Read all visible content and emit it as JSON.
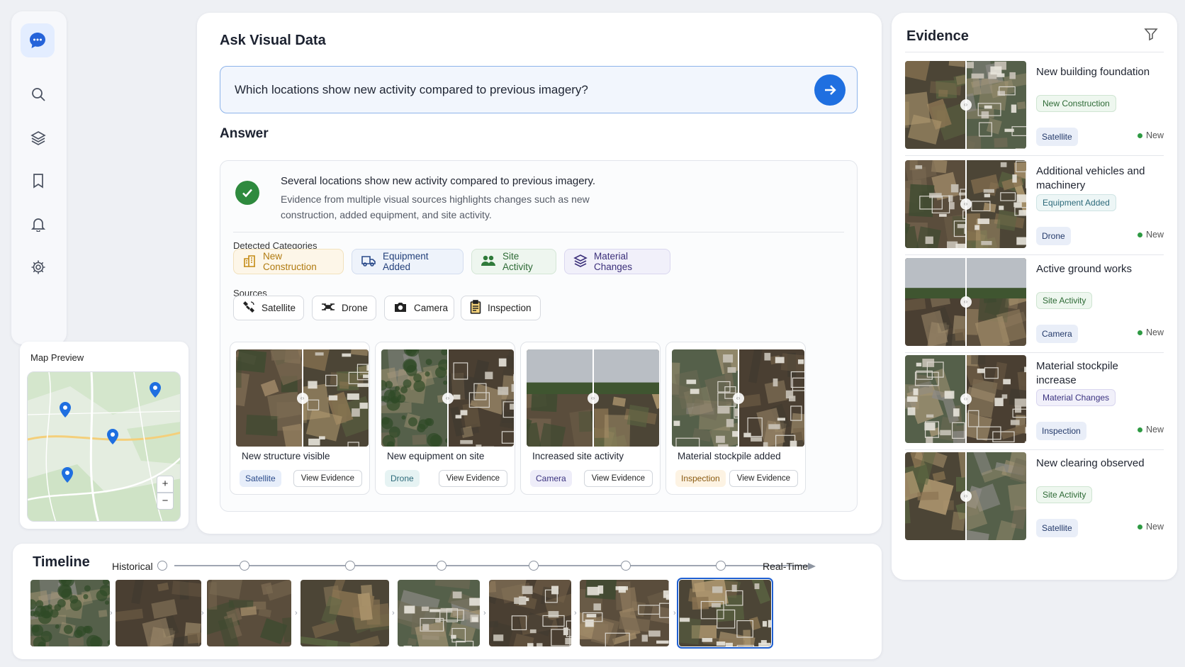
{
  "sidebar": {
    "items": [
      {
        "icon": "search-icon"
      },
      {
        "icon": "layers-icon"
      },
      {
        "icon": "bookmark-icon"
      },
      {
        "icon": "bell-icon"
      },
      {
        "icon": "gear-icon"
      }
    ]
  },
  "map": {
    "title": "Map Preview",
    "zoom_in": "+",
    "zoom_out": "−"
  },
  "ask": {
    "title": "Ask Visual Data",
    "query": "Which locations show new activity compared to previous imagery?"
  },
  "answer": {
    "title": "Answer",
    "summary": "Several locations show new activity compared to previous imagery.",
    "detail": "Evidence from multiple visual sources highlights changes such as new construction, added equipment, and site activity.",
    "categories_label": "Detected Categories",
    "categories": [
      {
        "label": "New Construction",
        "icon": "building-icon",
        "color": "#b07a10",
        "bg": "#fdf6e8",
        "border": "#f2e1bc"
      },
      {
        "label": "Equipment Added",
        "icon": "truck-icon",
        "color": "#23407a",
        "bg": "#eef3fb",
        "border": "#d3ddef"
      },
      {
        "label": "Site Activity",
        "icon": "people-icon",
        "color": "#2d6a35",
        "bg": "#eef6ef",
        "border": "#d4e6d6"
      },
      {
        "label": "Material Changes",
        "icon": "layers-icon",
        "color": "#3b2f7a",
        "bg": "#f1f0fa",
        "border": "#dad7ef"
      }
    ],
    "sources_label": "Sources",
    "sources": [
      {
        "label": "Satellite",
        "icon": "satellite-icon"
      },
      {
        "label": "Drone",
        "icon": "drone-icon"
      },
      {
        "label": "Camera",
        "icon": "camera-icon"
      },
      {
        "label": "Inspection",
        "icon": "clipboard-icon"
      }
    ],
    "evidence_cards": [
      {
        "caption": "New structure visible",
        "tag": "Satellite",
        "tag_color": "#2a4a8a",
        "tag_bg": "#e7eefa",
        "button": "View Evidence"
      },
      {
        "caption": "New equipment on site",
        "tag": "Drone",
        "tag_color": "#2d6a7a",
        "tag_bg": "#e6f3f3",
        "button": "View Evidence"
      },
      {
        "caption": "Increased site activity",
        "tag": "Camera",
        "tag_color": "#3b3380",
        "tag_bg": "#eeedf9",
        "button": "View Evidence"
      },
      {
        "caption": "Material stockpile added",
        "tag": "Inspection",
        "tag_color": "#8a5a10",
        "tag_bg": "#fdf3e3",
        "button": "View Evidence"
      }
    ]
  },
  "evidence": {
    "title": "Evidence",
    "items": [
      {
        "title": "New building foundation",
        "category": "New Construction",
        "cat_color": "#2d6a35",
        "cat_bg": "#eef7ef",
        "cat_border": "#cfe5d2",
        "source": "Satellite",
        "status": "New"
      },
      {
        "title": "Additional vehicles and machinery",
        "category": "Equipment Added",
        "cat_color": "#2d6a7a",
        "cat_bg": "#edf6f6",
        "cat_border": "#cfe4e4",
        "source": "Drone",
        "status": "New"
      },
      {
        "title": "Active ground works",
        "category": "Site Activity",
        "cat_color": "#2d6a35",
        "cat_bg": "#eef7ef",
        "cat_border": "#cfe5d2",
        "source": "Camera",
        "status": "New"
      },
      {
        "title": "Material stockpile increase",
        "category": "Material Changes",
        "cat_color": "#3b3380",
        "cat_bg": "#f1f0fa",
        "cat_border": "#d9d6ef",
        "source": "Inspection",
        "status": "New"
      },
      {
        "title": "New clearing observed",
        "category": "Site Activity",
        "cat_color": "#2d6a35",
        "cat_bg": "#eef7ef",
        "cat_border": "#cfe5d2",
        "source": "Satellite",
        "status": "New"
      }
    ]
  },
  "timeline": {
    "title": "Timeline",
    "start_label": "Historical",
    "end_label": "Real-Time",
    "frames": 8,
    "selected_frame": 8
  },
  "colors": {
    "accent": "#1f6fe0",
    "success": "#2e8a3e"
  }
}
